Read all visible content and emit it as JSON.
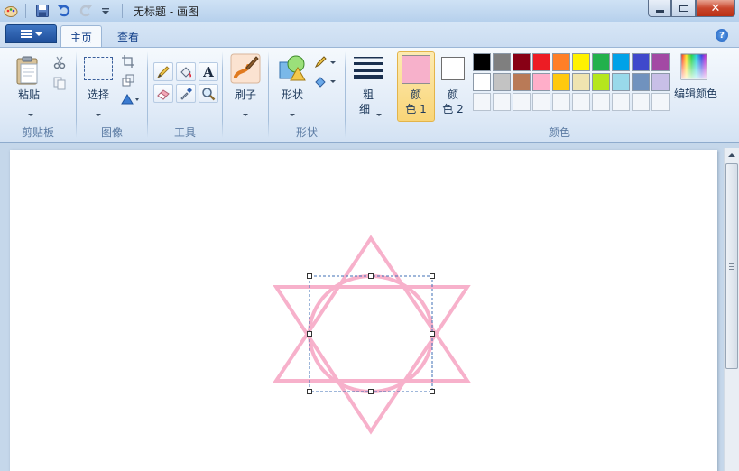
{
  "window": {
    "title": "无标题 - 画图",
    "quick_access": [
      "paint-app-icon",
      "save-icon",
      "undo-icon",
      "redo-icon",
      "customize-dropdown-icon"
    ]
  },
  "tabs": [
    {
      "label": "主页",
      "active": true
    },
    {
      "label": "查看",
      "active": false
    }
  ],
  "groups": {
    "clipboard": {
      "label": "剪贴板",
      "paste_label": "粘贴"
    },
    "image": {
      "label": "图像",
      "select_label": "选择"
    },
    "tools": {
      "label": "工具"
    },
    "brushes": {
      "brush_label": "刷子"
    },
    "shapes": {
      "label": "形状",
      "shapes_label": "形状"
    },
    "size": {
      "label_line1": "粗",
      "label_line2": "细"
    },
    "colors": {
      "label": "颜色",
      "color1_line1": "颜",
      "color1_line2": "色 1",
      "color2_line1": "颜",
      "color2_line2": "色 2",
      "edit_label": "编辑颜色",
      "color1_value": "#f7b1cb",
      "color2_value": "#ffffff",
      "palette_row1": [
        "#000000",
        "#7f7f7f",
        "#880015",
        "#ed1c24",
        "#ff7f27",
        "#fff200",
        "#22b14c",
        "#00a2e8",
        "#3f48cc",
        "#a349a4"
      ],
      "palette_row2": [
        "#ffffff",
        "#c3c3c3",
        "#b97a57",
        "#ffaec9",
        "#ffc90e",
        "#efe4b0",
        "#b5e61d",
        "#99d9ea",
        "#7092be",
        "#c8bfe7"
      ],
      "palette_row3_empty": 10
    }
  },
  "drawing": {
    "stroke_color": "#f7b1cb"
  }
}
